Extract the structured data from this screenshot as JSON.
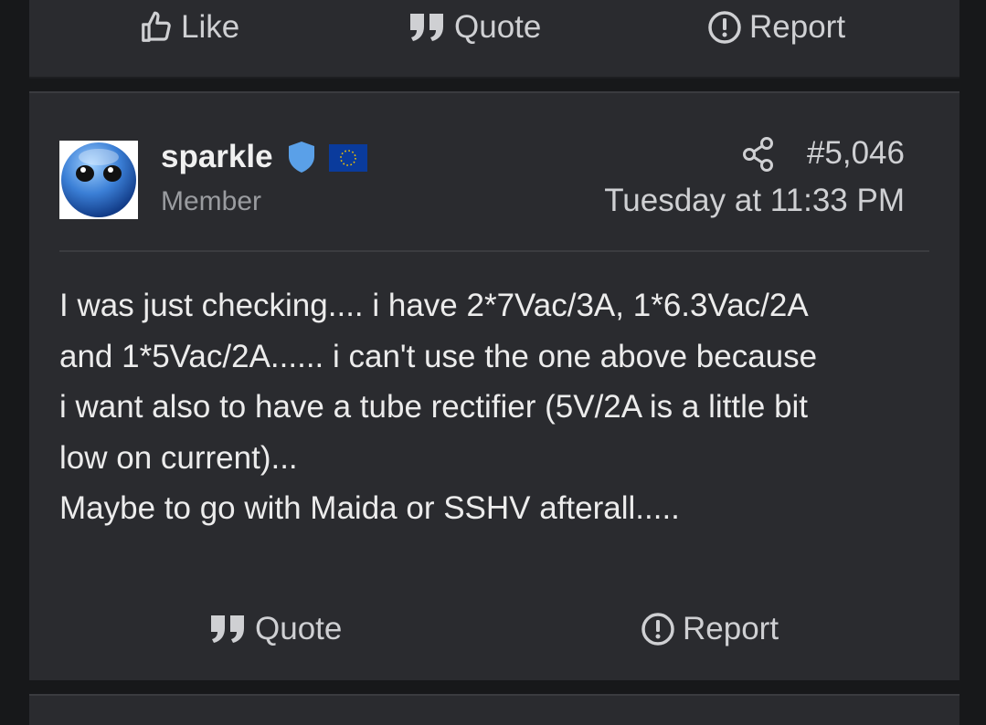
{
  "prev_post": {
    "like_label": "Like",
    "quote_label": "Quote",
    "report_label": "Report"
  },
  "post": {
    "username": "sparkle",
    "role": "Member",
    "post_number": "#5,046",
    "timestamp": "Tuesday at 11:33 PM",
    "body_lines": [
      "I was just checking.... i have 2*7Vac/3A, 1*6.3Vac/2A",
      "and 1*5Vac/2A...... i can't use the one above because",
      "i want also to have a tube rectifier (5V/2A is a little bit",
      "low on current)...",
      "Maybe to go with Maida or SSHV afterall....."
    ],
    "quote_label": "Quote",
    "report_label": "Report"
  },
  "colors": {
    "background": "#17181a",
    "card": "#2a2b2f",
    "text": "#ececec",
    "muted": "#9a9ca0",
    "verified_badge": "#5aa0e8",
    "flag_blue": "#0a3b9c"
  },
  "icons": {
    "like": "thumbs-up-icon",
    "quote": "quote-icon",
    "report": "exclamation-circle-icon",
    "share": "share-icon",
    "verified": "shield-check-icon",
    "flag": "eu-flag-icon"
  }
}
